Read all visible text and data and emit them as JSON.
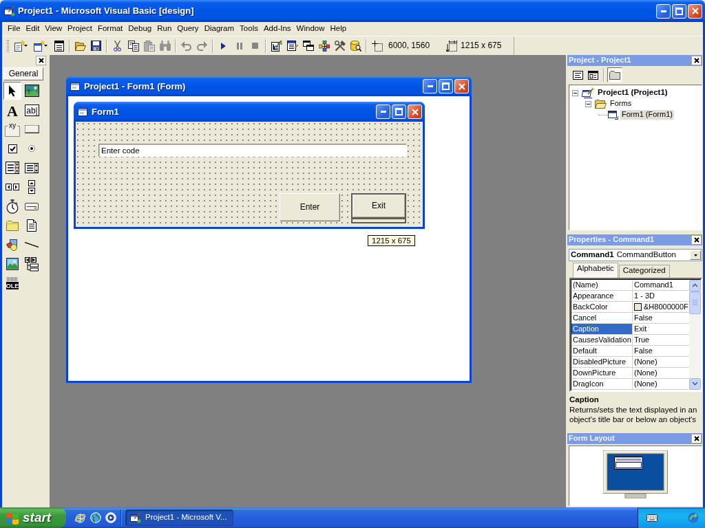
{
  "window": {
    "title": "Project1 - Microsoft Visual Basic [design]"
  },
  "menu": [
    "File",
    "Edit",
    "View",
    "Project",
    "Format",
    "Debug",
    "Run",
    "Query",
    "Diagram",
    "Tools",
    "Add-Ins",
    "Window",
    "Help"
  ],
  "toolbar": {
    "groups": [
      [
        {
          "kind": "add-project",
          "disabled": false
        },
        {
          "kind": "dropdown",
          "disabled": false
        },
        {
          "kind": "add-form",
          "disabled": false
        },
        {
          "kind": "dropdown",
          "disabled": false
        },
        {
          "kind": "menu-editor",
          "disabled": false
        }
      ],
      [
        {
          "kind": "open",
          "disabled": false
        },
        {
          "kind": "save",
          "disabled": false
        }
      ],
      [
        {
          "kind": "cut",
          "disabled": false
        },
        {
          "kind": "copy",
          "disabled": false
        },
        {
          "kind": "paste",
          "disabled": true
        },
        {
          "kind": "find",
          "disabled": true
        }
      ],
      [
        {
          "kind": "undo",
          "disabled": true
        },
        {
          "kind": "redo",
          "disabled": true
        }
      ],
      [
        {
          "kind": "start",
          "disabled": false
        },
        {
          "kind": "break",
          "disabled": true
        },
        {
          "kind": "end",
          "disabled": true
        }
      ],
      [
        {
          "kind": "project-explorer",
          "disabled": false
        },
        {
          "kind": "properties",
          "disabled": false
        },
        {
          "kind": "form-layout",
          "disabled": false
        },
        {
          "kind": "object-browser",
          "disabled": false
        },
        {
          "kind": "toolbox",
          "disabled": false
        },
        {
          "kind": "data-view",
          "disabled": false
        }
      ]
    ],
    "position": "6000, 1560",
    "size": "1215 x 675"
  },
  "toolbox": {
    "tab": "General",
    "tools": [
      {
        "kind": "pointer",
        "selected": true
      },
      {
        "kind": "picture-box",
        "selected": false
      },
      {
        "kind": "label",
        "glyph": "A",
        "selected": false
      },
      {
        "kind": "text-box",
        "glyph": "ab|",
        "selected": false
      },
      {
        "kind": "frame",
        "glyph": "xy",
        "selected": false
      },
      {
        "kind": "command-button",
        "selected": false
      },
      {
        "kind": "check-box",
        "selected": false
      },
      {
        "kind": "option-button",
        "selected": false
      },
      {
        "kind": "combo-box",
        "selected": false
      },
      {
        "kind": "list-box",
        "selected": false
      },
      {
        "kind": "h-scroll-bar",
        "selected": false
      },
      {
        "kind": "v-scroll-bar",
        "selected": false
      },
      {
        "kind": "timer",
        "selected": false
      },
      {
        "kind": "drive-list",
        "selected": false
      },
      {
        "kind": "dir-list",
        "selected": false
      },
      {
        "kind": "file-list",
        "selected": false
      },
      {
        "kind": "shape",
        "selected": false
      },
      {
        "kind": "line",
        "selected": false
      },
      {
        "kind": "image",
        "selected": false
      },
      {
        "kind": "data",
        "selected": false
      },
      {
        "kind": "ole",
        "glyph": "OLE",
        "selected": false
      }
    ]
  },
  "designer": {
    "title": "Project1 - Form1 (Form)",
    "form": {
      "title": "Form1",
      "textbox": {
        "value": "Enter code"
      },
      "buttons": [
        {
          "caption": "Enter",
          "selected": false
        },
        {
          "caption": "Exit",
          "selected": true
        }
      ]
    },
    "size_tip": "1215 x 675"
  },
  "project": {
    "title": "Project - Project1",
    "tools": [
      {
        "kind": "view-code",
        "on": false
      },
      {
        "kind": "view-object",
        "on": false
      },
      {
        "kind": "toggle-folders",
        "on": true
      }
    ],
    "tree": [
      {
        "kind": "project",
        "label": "Project1 (Project1)",
        "expanded": true,
        "selected": false,
        "children": [
          {
            "kind": "folder",
            "label": "Forms",
            "expanded": true,
            "selected": false,
            "children": [
              {
                "kind": "form",
                "label": "Form1 (Form1)",
                "selected": true
              }
            ]
          }
        ]
      }
    ]
  },
  "properties": {
    "title": "Properties - Command1",
    "object": {
      "name": "Command1",
      "type": "CommandButton"
    },
    "tabs": [
      {
        "label": "Alphabetic",
        "selected": true
      },
      {
        "label": "Categorized",
        "selected": false
      }
    ],
    "rows": [
      {
        "name": "(Name)",
        "value": "Command1",
        "kind": "text",
        "selected": false
      },
      {
        "name": "Appearance",
        "value": "1 - 3D",
        "kind": "text",
        "selected": false
      },
      {
        "name": "BackColor",
        "value": "&H8000000F",
        "kind": "color",
        "selected": false
      },
      {
        "name": "Cancel",
        "value": "False",
        "kind": "text",
        "selected": false
      },
      {
        "name": "Caption",
        "value": "Exit",
        "kind": "text",
        "selected": true
      },
      {
        "name": "CausesValidation",
        "value": "True",
        "kind": "text",
        "selected": false
      },
      {
        "name": "Default",
        "value": "False",
        "kind": "text",
        "selected": false
      },
      {
        "name": "DisabledPicture",
        "value": "(None)",
        "kind": "text",
        "selected": false
      },
      {
        "name": "DownPicture",
        "value": "(None)",
        "kind": "text",
        "selected": false
      },
      {
        "name": "DragIcon",
        "value": "(None)",
        "kind": "text",
        "selected": false
      }
    ],
    "description": {
      "title": "Caption",
      "text": "Returns/sets the text displayed in an object's title bar or below an object's"
    }
  },
  "form_layout": {
    "title": "Form Layout"
  },
  "taskbar": {
    "start": "start",
    "quick_launch": [
      {
        "kind": "browser"
      },
      {
        "kind": "globe"
      },
      {
        "kind": "media"
      }
    ],
    "tasks": [
      {
        "label": "Project1 - Microsoft V...",
        "selected": true
      }
    ],
    "tray": [
      {
        "kind": "keyboard"
      },
      {
        "kind": "arrow"
      }
    ]
  }
}
